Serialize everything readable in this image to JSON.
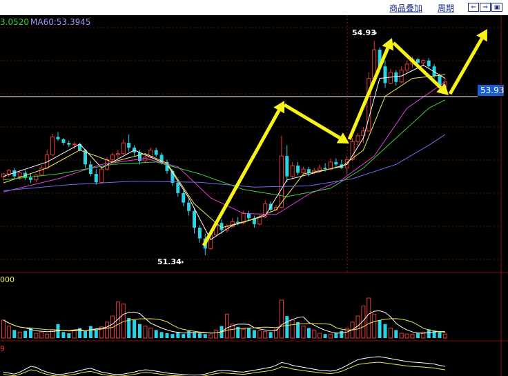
{
  "toolbar": {
    "overlay_label": "商品叠加",
    "period_label": "周期",
    "nav_icons": [
      "left-arrow-icon",
      "right-arrow-icon",
      "expand-icon"
    ]
  },
  "indicators": {
    "ma_partial_value": "3.0520",
    "ma60_label": "MA60:53.3945",
    "volume_axis_label": "000",
    "sub_axis_label": "9"
  },
  "colors": {
    "up": "#e83a3a",
    "down": "#2ad4e6",
    "ma5": "#ffffff",
    "ma10": "#f2e94e",
    "ma20": "#e040e0",
    "ma30": "#3ed13e",
    "ma60": "#7070f0",
    "arrow": "#f7f21a",
    "price_line": "#ffffff",
    "price_tag_bg": "#1a5fd0"
  },
  "chart_data": {
    "type": "candlestick",
    "current_price": 53.93,
    "current_price_label": "53.93",
    "high_label": "54.93",
    "low_label": "51.34",
    "high": 54.93,
    "low": 51.34,
    "ylim": [
      51.2,
      55.15
    ],
    "candles": [
      [
        52.65,
        52.72,
        52.58,
        52.7
      ],
      [
        52.7,
        52.78,
        52.65,
        52.76
      ],
      [
        52.76,
        52.8,
        52.62,
        52.66
      ],
      [
        52.66,
        52.74,
        52.6,
        52.72
      ],
      [
        52.72,
        52.76,
        52.6,
        52.64
      ],
      [
        52.64,
        52.7,
        52.55,
        52.6
      ],
      [
        52.6,
        52.7,
        52.56,
        52.68
      ],
      [
        52.68,
        52.85,
        52.66,
        52.8
      ],
      [
        52.8,
        53.1,
        52.78,
        53.02
      ],
      [
        53.02,
        53.38,
        53.0,
        53.32
      ],
      [
        53.32,
        53.4,
        53.25,
        53.28
      ],
      [
        53.28,
        53.3,
        53.18,
        53.22
      ],
      [
        53.22,
        53.26,
        53.15,
        53.19
      ],
      [
        53.19,
        53.24,
        53.12,
        53.2
      ],
      [
        53.2,
        53.22,
        53.08,
        53.1
      ],
      [
        53.1,
        53.12,
        52.8,
        52.86
      ],
      [
        52.86,
        52.92,
        52.66,
        52.7
      ],
      [
        52.7,
        52.78,
        52.52,
        52.56
      ],
      [
        52.56,
        52.84,
        52.54,
        52.78
      ],
      [
        52.78,
        52.98,
        52.76,
        52.94
      ],
      [
        52.94,
        53.06,
        52.9,
        53.02
      ],
      [
        53.02,
        53.1,
        52.96,
        53.04
      ],
      [
        53.04,
        53.28,
        53.02,
        53.22
      ],
      [
        53.22,
        53.36,
        53.08,
        53.14
      ],
      [
        53.14,
        53.18,
        53.0,
        53.06
      ],
      [
        53.06,
        53.1,
        52.86,
        52.92
      ],
      [
        52.92,
        53.02,
        52.88,
        52.98
      ],
      [
        52.98,
        53.14,
        52.96,
        53.1
      ],
      [
        53.1,
        53.14,
        52.98,
        53.02
      ],
      [
        53.02,
        53.06,
        52.86,
        52.9
      ],
      [
        52.9,
        52.94,
        52.7,
        52.75
      ],
      [
        52.75,
        52.78,
        52.5,
        52.55
      ],
      [
        52.55,
        52.58,
        52.32,
        52.38
      ],
      [
        52.38,
        52.42,
        52.16,
        52.22
      ],
      [
        52.22,
        52.28,
        52.0,
        52.08
      ],
      [
        52.08,
        52.12,
        51.7,
        51.8
      ],
      [
        51.8,
        51.84,
        51.55,
        51.62
      ],
      [
        51.62,
        51.7,
        51.34,
        51.45
      ],
      [
        51.45,
        51.72,
        51.43,
        51.68
      ],
      [
        51.68,
        51.92,
        51.66,
        51.88
      ],
      [
        51.88,
        51.94,
        51.7,
        51.76
      ],
      [
        51.76,
        51.86,
        51.72,
        51.82
      ],
      [
        51.82,
        51.96,
        51.8,
        51.9
      ],
      [
        51.9,
        51.98,
        51.84,
        51.88
      ],
      [
        51.88,
        52.08,
        51.86,
        52.04
      ],
      [
        52.04,
        52.08,
        51.92,
        51.96
      ],
      [
        51.96,
        52.0,
        51.8,
        51.86
      ],
      [
        51.86,
        52.02,
        51.84,
        51.98
      ],
      [
        51.98,
        52.26,
        51.96,
        52.2
      ],
      [
        52.2,
        52.24,
        52.06,
        52.1
      ],
      [
        52.1,
        52.18,
        52.08,
        52.14
      ],
      [
        52.14,
        53.34,
        52.12,
        53.0
      ],
      [
        53.0,
        53.18,
        52.56,
        52.66
      ],
      [
        52.66,
        52.9,
        52.62,
        52.84
      ],
      [
        52.84,
        52.9,
        52.68,
        52.72
      ],
      [
        52.72,
        52.82,
        52.7,
        52.78
      ],
      [
        52.78,
        52.82,
        52.66,
        52.72
      ],
      [
        52.72,
        52.8,
        52.7,
        52.76
      ],
      [
        52.76,
        52.86,
        52.72,
        52.8
      ],
      [
        52.8,
        52.88,
        52.74,
        52.78
      ],
      [
        52.78,
        52.96,
        52.76,
        52.9
      ],
      [
        52.9,
        52.96,
        52.82,
        52.86
      ],
      [
        52.86,
        52.94,
        52.78,
        52.8
      ],
      [
        52.8,
        53.0,
        52.7,
        52.94
      ],
      [
        52.94,
        53.3,
        52.92,
        53.24
      ],
      [
        53.24,
        53.38,
        53.18,
        53.34
      ],
      [
        53.34,
        53.48,
        53.22,
        53.42
      ],
      [
        53.42,
        54.4,
        53.4,
        54.3
      ],
      [
        54.3,
        54.93,
        54.26,
        54.78
      ],
      [
        54.78,
        54.82,
        54.44,
        54.5
      ],
      [
        54.5,
        54.6,
        54.14,
        54.22
      ],
      [
        54.22,
        54.46,
        54.2,
        54.4
      ],
      [
        54.4,
        54.44,
        54.18,
        54.24
      ],
      [
        54.24,
        54.5,
        54.22,
        54.44
      ],
      [
        54.44,
        54.6,
        54.4,
        54.54
      ],
      [
        54.54,
        54.66,
        54.48,
        54.62
      ],
      [
        54.62,
        54.64,
        54.52,
        54.56
      ],
      [
        54.56,
        54.62,
        54.5,
        54.6
      ],
      [
        54.6,
        54.64,
        54.46,
        54.5
      ],
      [
        54.5,
        54.54,
        54.3,
        54.34
      ],
      [
        54.34,
        54.38,
        54.1,
        54.16
      ],
      [
        54.16,
        54.3,
        54.12,
        54.24
      ]
    ],
    "ma5": [
      [
        0,
        52.66
      ],
      [
        8,
        52.9
      ],
      [
        14,
        53.2
      ],
      [
        18,
        52.8
      ],
      [
        24,
        53.1
      ],
      [
        30,
        52.86
      ],
      [
        34,
        52.3
      ],
      [
        38,
        51.6
      ],
      [
        42,
        51.84
      ],
      [
        48,
        52.0
      ],
      [
        52,
        52.6
      ],
      [
        58,
        52.74
      ],
      [
        63,
        52.86
      ],
      [
        66,
        53.3
      ],
      [
        69,
        54.3
      ],
      [
        73,
        54.34
      ],
      [
        77,
        54.52
      ],
      [
        81,
        54.3
      ]
    ],
    "ma10": [
      [
        0,
        52.55
      ],
      [
        8,
        52.8
      ],
      [
        14,
        53.1
      ],
      [
        20,
        52.9
      ],
      [
        26,
        53.04
      ],
      [
        30,
        52.88
      ],
      [
        35,
        52.2
      ],
      [
        40,
        51.8
      ],
      [
        46,
        51.95
      ],
      [
        50,
        52.1
      ],
      [
        55,
        52.7
      ],
      [
        62,
        52.82
      ],
      [
        66,
        53.1
      ],
      [
        70,
        54.0
      ],
      [
        75,
        54.3
      ],
      [
        81,
        54.36
      ]
    ],
    "ma20": [
      [
        0,
        52.4
      ],
      [
        10,
        52.62
      ],
      [
        18,
        52.86
      ],
      [
        26,
        52.96
      ],
      [
        32,
        52.82
      ],
      [
        38,
        52.3
      ],
      [
        44,
        52.04
      ],
      [
        50,
        52.02
      ],
      [
        56,
        52.36
      ],
      [
        62,
        52.6
      ],
      [
        68,
        53.0
      ],
      [
        74,
        53.8
      ],
      [
        81,
        54.24
      ]
    ],
    "ma30": [
      [
        0,
        52.6
      ],
      [
        10,
        52.7
      ],
      [
        20,
        52.86
      ],
      [
        28,
        52.9
      ],
      [
        36,
        52.7
      ],
      [
        44,
        52.44
      ],
      [
        52,
        52.32
      ],
      [
        60,
        52.46
      ],
      [
        66,
        52.8
      ],
      [
        72,
        53.3
      ],
      [
        78,
        53.8
      ],
      [
        81,
        53.94
      ]
    ],
    "ma60": [
      [
        0,
        52.42
      ],
      [
        12,
        52.52
      ],
      [
        24,
        52.58
      ],
      [
        36,
        52.56
      ],
      [
        46,
        52.48
      ],
      [
        56,
        52.5
      ],
      [
        64,
        52.62
      ],
      [
        72,
        52.86
      ],
      [
        78,
        53.18
      ],
      [
        81,
        53.36
      ]
    ],
    "volumes": [
      0.45,
      0.3,
      0.2,
      0.15,
      0.18,
      0.25,
      0.12,
      0.15,
      0.1,
      0.2,
      0.35,
      0.15,
      0.12,
      0.2,
      0.25,
      0.18,
      0.3,
      0.22,
      0.28,
      0.4,
      0.55,
      0.9,
      0.85,
      0.5,
      0.45,
      0.35,
      0.3,
      0.25,
      0.2,
      0.15,
      0.12,
      0.1,
      0.15,
      0.1,
      0.18,
      0.15,
      0.12,
      0.1,
      0.08,
      0.2,
      0.3,
      0.6,
      0.35,
      0.28,
      0.22,
      0.25,
      0.2,
      0.18,
      0.16,
      0.15,
      0.22,
      0.95,
      0.55,
      0.45,
      0.4,
      0.3,
      0.25,
      0.2,
      0.12,
      0.1,
      0.1,
      0.12,
      0.18,
      0.25,
      0.4,
      0.55,
      0.8,
      1.0,
      0.6,
      0.45,
      0.35,
      0.25,
      0.2,
      0.12,
      0.1,
      0.1,
      0.12,
      0.15,
      0.22,
      0.18,
      0.15,
      0.1
    ]
  }
}
